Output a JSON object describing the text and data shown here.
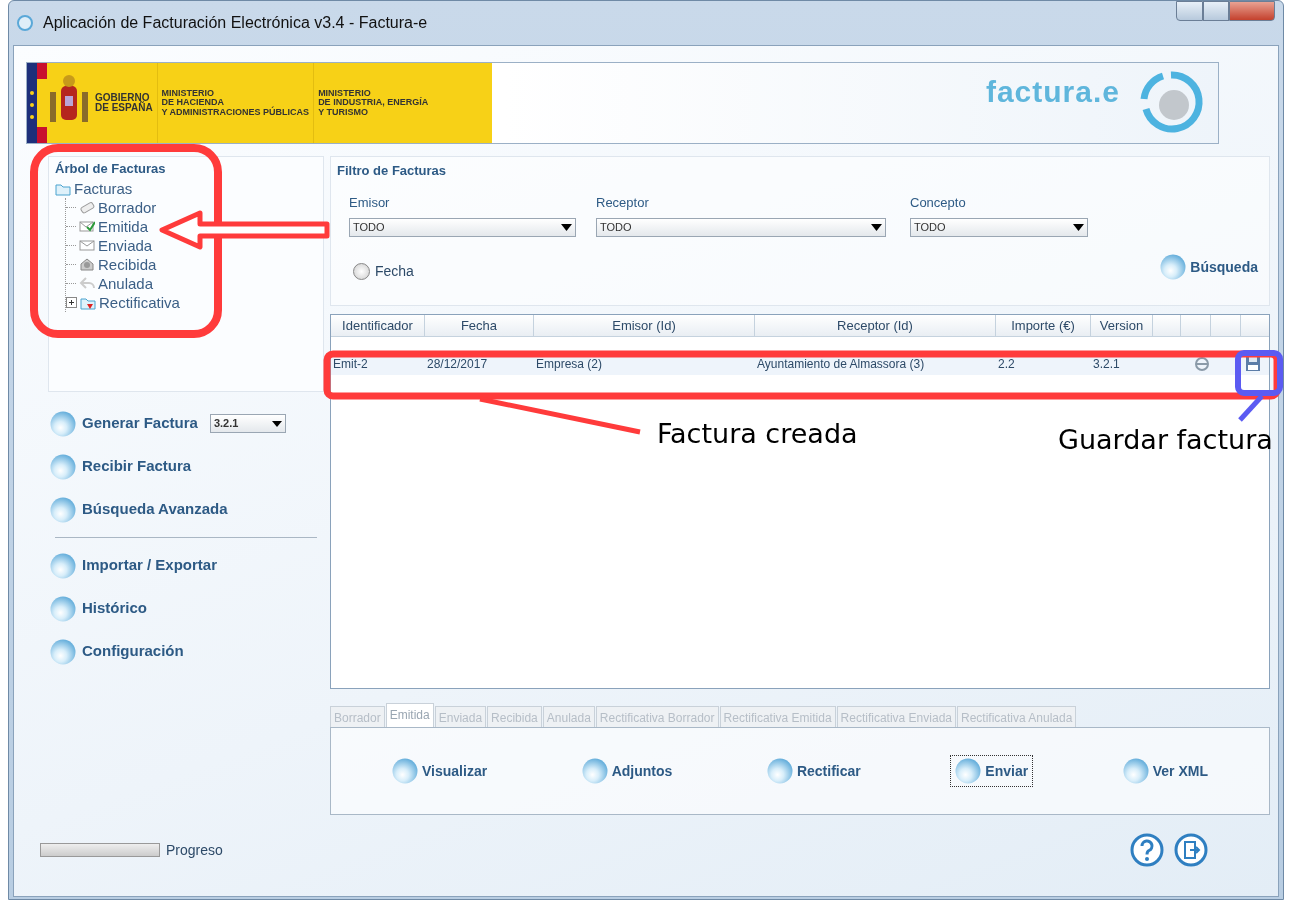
{
  "window": {
    "title": "Aplicación de Facturación Electrónica v3.4 - Factura-e"
  },
  "banner": {
    "gobierno": [
      "GOBIERNO",
      "DE ESPAÑA"
    ],
    "ministerio_1": [
      "MINISTERIO",
      "DE HACIENDA",
      "Y ADMINISTRACIONES PÚBLICAS"
    ],
    "ministerio_2": [
      "MINISTERIO",
      "DE INDUSTRIA, ENERGÍA",
      "Y TURISMO"
    ],
    "logo": "factura.e"
  },
  "tree": {
    "title": "Árbol de Facturas",
    "root": {
      "label": "Facturas",
      "kind": "folder",
      "children": [
        {
          "label": "Borrador",
          "kind": "draft"
        },
        {
          "label": "Emitida",
          "kind": "issued"
        },
        {
          "label": "Enviada",
          "kind": "sent"
        },
        {
          "label": "Recibida",
          "kind": "received"
        },
        {
          "label": "Anulada",
          "kind": "cancelled"
        },
        {
          "label": "Rectificativa",
          "kind": "corrective",
          "expanded": false
        }
      ]
    }
  },
  "actions": [
    [
      {
        "label": "Generar Factura",
        "version": "3.2.1"
      },
      {
        "label": "Recibir Factura"
      },
      {
        "label": "Búsqueda Avanzada"
      }
    ],
    [
      {
        "label": "Importar / Exportar"
      },
      {
        "label": "Histórico"
      },
      {
        "label": "Configuración"
      }
    ]
  ],
  "filter": {
    "title": "Filtro de Facturas",
    "fields": [
      {
        "label": "Emisor",
        "value": "TODO"
      },
      {
        "label": "Receptor",
        "value": "TODO"
      },
      {
        "label": "Concepto",
        "value": "TODO"
      }
    ],
    "date_radio": {
      "label": "Fecha",
      "checked": false
    },
    "search_button": "Búsqueda"
  },
  "table": {
    "columns": [
      "Identificador",
      "Fecha",
      "Emisor (Id)",
      "Receptor (Id)",
      "Importe (€)",
      "Version"
    ],
    "rows": [
      {
        "cells": [
          "Emit-2",
          "28/12/2017",
          "Empresa (2)",
          "Ayuntamiento de Almassora (3)",
          "2.2",
          "3.2.1"
        ]
      }
    ]
  },
  "tabs": [
    {
      "label": "Borrador",
      "selected": false
    },
    {
      "label": "Emitida",
      "selected": true
    },
    {
      "label": "Enviada",
      "selected": false
    },
    {
      "label": "Recibida",
      "selected": false
    },
    {
      "label": "Anulada",
      "selected": false
    },
    {
      "label": "Rectificativa Borrador",
      "selected": false
    },
    {
      "label": "Rectificativa Emitida",
      "selected": false
    },
    {
      "label": "Rectificativa Enviada",
      "selected": false
    },
    {
      "label": "Rectificativa Anulada",
      "selected": false
    }
  ],
  "tab_buttons": [
    {
      "label": "Visualizar",
      "focused": false
    },
    {
      "label": "Adjuntos",
      "focused": false
    },
    {
      "label": "Rectificar",
      "focused": false
    },
    {
      "label": "Enviar",
      "focused": true
    },
    {
      "label": "Ver XML",
      "focused": false
    }
  ],
  "progress": {
    "label": "Progreso",
    "level": 0
  },
  "annotations": [
    {
      "kind": "tree_frame",
      "color": "#ff3b3b"
    },
    {
      "kind": "arrow",
      "color": "#ff3b3b"
    },
    {
      "kind": "row_frame",
      "color": "#ff3b3b",
      "text": "Factura creada"
    },
    {
      "kind": "save_frame",
      "color": "#5b5bf2",
      "text": "Guardar factura"
    }
  ]
}
